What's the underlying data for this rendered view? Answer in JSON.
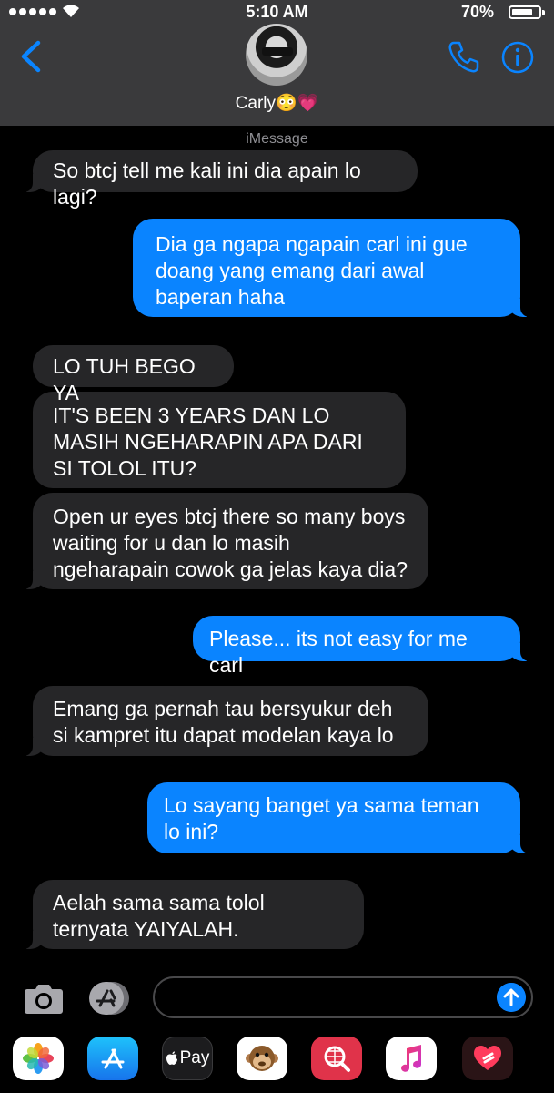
{
  "status_bar": {
    "time": "5:10 AM",
    "battery": "70%"
  },
  "header": {
    "contact_name": "Carly😳💗"
  },
  "service_label": "iMessage",
  "messages": [
    {
      "from": "them",
      "text": "So btcj tell me kali ini dia apain lo lagi?"
    },
    {
      "from": "me",
      "text": "Dia ga ngapa ngapain carl ini gue doang yang emang dari awal baperan haha"
    },
    {
      "from": "them",
      "text": "LO TUH BEGO YA"
    },
    {
      "from": "them",
      "text": "IT'S BEEN 3 YEARS DAN LO MASIH NGEHARAPIN APA DARI SI TOLOL ITU?"
    },
    {
      "from": "them",
      "text": "Open ur eyes btcj there so many boys waiting for u dan lo masih ngeharapain cowok ga jelas kaya dia?"
    },
    {
      "from": "me",
      "text": "Please... its not easy for me carl"
    },
    {
      "from": "them",
      "text": "Emang ga pernah tau bersyukur deh si kampret itu dapat modelan kaya lo"
    },
    {
      "from": "me",
      "text": "Lo sayang banget ya sama teman lo ini?"
    },
    {
      "from": "them",
      "text": "Aelah sama sama tolol ternyata YAIYALAH."
    }
  ],
  "composer": {
    "value": ""
  },
  "app_drawer": {
    "apps": [
      {
        "name": "photos-icon"
      },
      {
        "name": "app-store-icon"
      },
      {
        "name": "apple-pay-icon",
        "label": "Pay"
      },
      {
        "name": "animoji-icon"
      },
      {
        "name": "images-search-icon"
      },
      {
        "name": "music-icon"
      },
      {
        "name": "digital-touch-icon"
      }
    ]
  },
  "colors": {
    "sent_bubble": "#0a84ff",
    "received_bubble": "#262628",
    "header_bg": "#3a3a3c"
  }
}
